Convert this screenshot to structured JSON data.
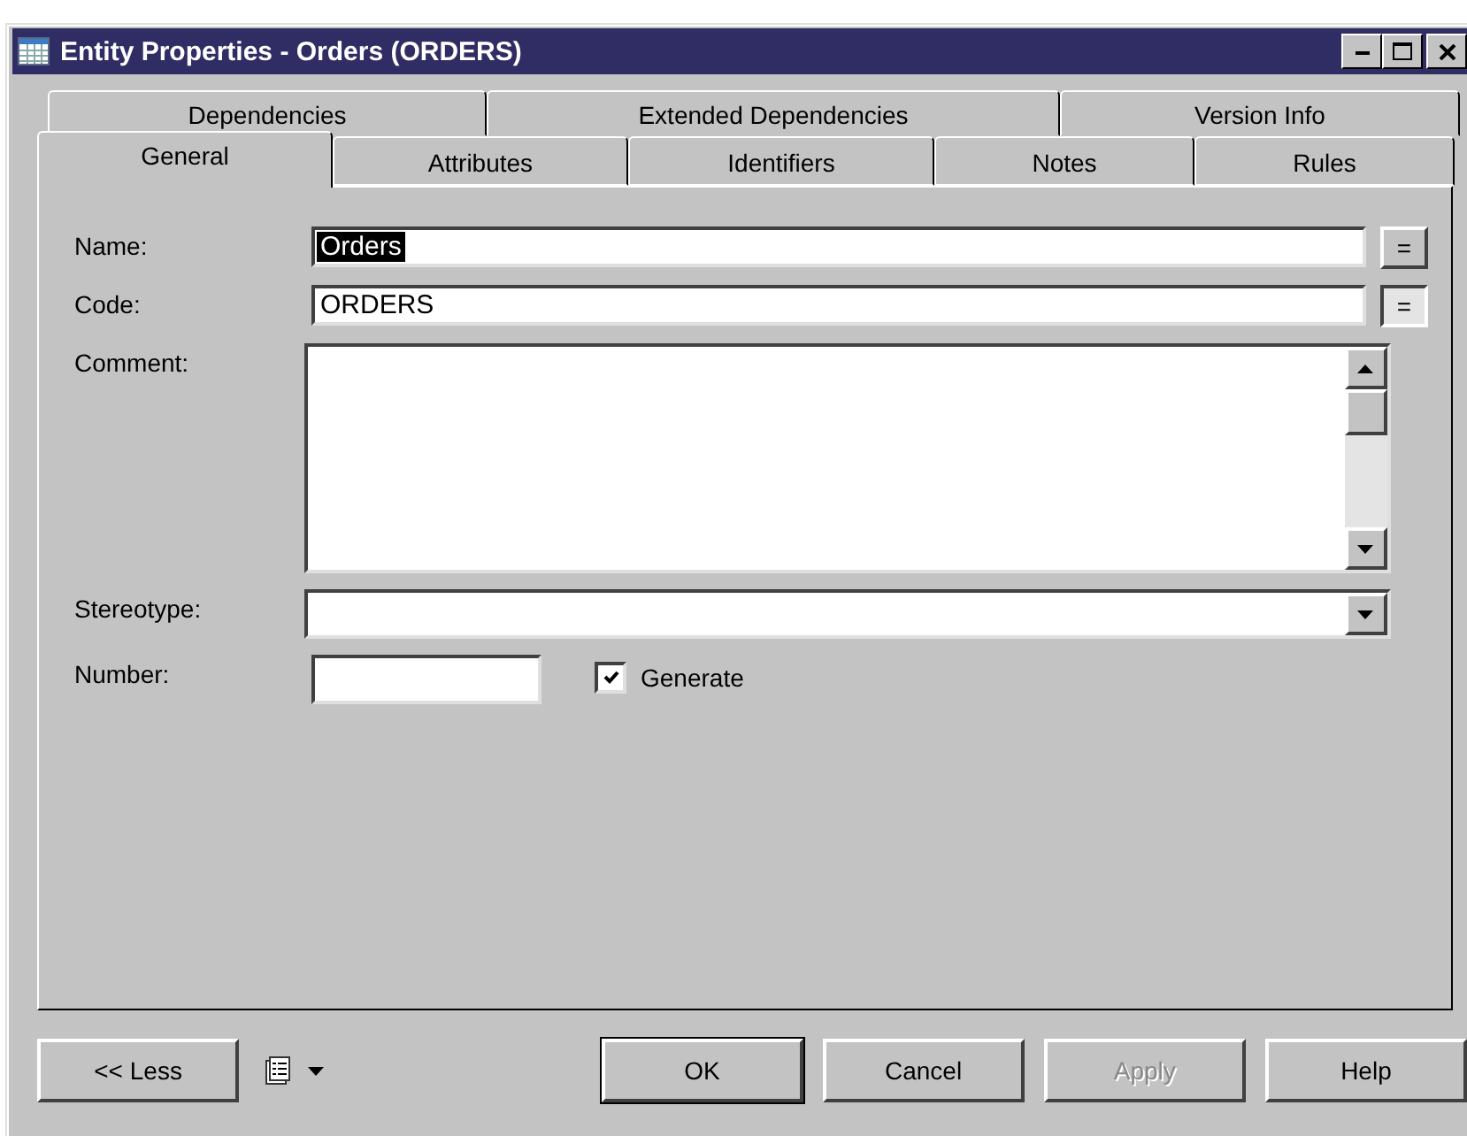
{
  "window": {
    "title": "Entity Properties - Orders (ORDERS)"
  },
  "tab_rows": [
    [
      {
        "label": "Dependencies",
        "selected": false
      },
      {
        "label": "Extended Dependencies",
        "selected": false
      },
      {
        "label": "Version Info",
        "selected": false
      }
    ],
    [
      {
        "label": "General",
        "selected": true
      },
      {
        "label": "Attributes",
        "selected": false
      },
      {
        "label": "Identifiers",
        "selected": false
      },
      {
        "label": "Notes",
        "selected": false
      },
      {
        "label": "Rules",
        "selected": false
      }
    ]
  ],
  "fields": [
    {
      "kind": "text",
      "label": "Name:",
      "value": "Orders",
      "value_selected": true,
      "equal_button": {
        "label": "=",
        "pressed": false
      }
    },
    {
      "kind": "text",
      "label": "Code:",
      "value": "ORDERS",
      "value_selected": false,
      "equal_button": {
        "label": "=",
        "pressed": true
      }
    },
    {
      "kind": "textarea",
      "label": "Comment:"
    },
    {
      "kind": "dropdown",
      "label": "Stereotype:"
    },
    {
      "kind": "number",
      "label": "Number:",
      "checkbox": {
        "label": "Generate",
        "checked": true
      }
    }
  ],
  "buttons": [
    {
      "label": "<< Less",
      "disabled": false,
      "default": false
    },
    {
      "label": "OK",
      "disabled": false,
      "default": true
    },
    {
      "label": "Cancel",
      "disabled": false,
      "default": false
    },
    {
      "label": "Apply",
      "disabled": true,
      "default": false
    },
    {
      "label": "Help",
      "disabled": false,
      "default": false
    }
  ]
}
